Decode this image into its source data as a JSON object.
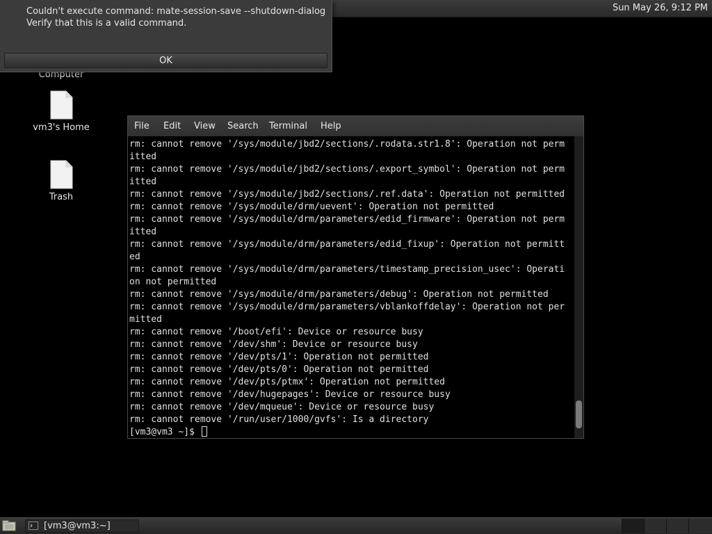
{
  "top_panel": {
    "clock": "Sun May 26,  9:12 PM"
  },
  "error_dialog": {
    "line1": "Couldn't execute command: mate-session-save --shutdown-dialog",
    "line2": "Verify that this is a valid command.",
    "ok_label": "OK"
  },
  "desktop_icons": {
    "computer": "Computer",
    "home": "vm3's Home",
    "trash": "Trash"
  },
  "terminal": {
    "menu": [
      "File",
      "Edit",
      "View",
      "Search",
      "Terminal",
      "Help"
    ],
    "lines": [
      "rm: cannot remove '/sys/module/jbd2/sections/.rodata.str1.8': Operation not perm",
      "itted",
      "rm: cannot remove '/sys/module/jbd2/sections/.export_symbol': Operation not perm",
      "itted",
      "rm: cannot remove '/sys/module/jbd2/sections/.ref.data': Operation not permitted",
      "rm: cannot remove '/sys/module/drm/uevent': Operation not permitted",
      "rm: cannot remove '/sys/module/drm/parameters/edid_firmware': Operation not perm",
      "itted",
      "rm: cannot remove '/sys/module/drm/parameters/edid_fixup': Operation not permitt",
      "ed",
      "rm: cannot remove '/sys/module/drm/parameters/timestamp_precision_usec': Operati",
      "on not permitted",
      "rm: cannot remove '/sys/module/drm/parameters/debug': Operation not permitted",
      "rm: cannot remove '/sys/module/drm/parameters/vblankoffdelay': Operation not per",
      "mitted",
      "rm: cannot remove '/boot/efi': Device or resource busy",
      "rm: cannot remove '/dev/shm': Device or resource busy",
      "rm: cannot remove '/dev/pts/1': Operation not permitted",
      "rm: cannot remove '/dev/pts/0': Operation not permitted",
      "rm: cannot remove '/dev/pts/ptmx': Operation not permitted",
      "rm: cannot remove '/dev/hugepages': Device or resource busy",
      "rm: cannot remove '/dev/mqueue': Device or resource busy",
      "rm: cannot remove '/run/user/1000/gvfs': Is a directory"
    ],
    "prompt": "[vm3@vm3 ~]$ "
  },
  "taskbar": {
    "window_label": "[vm3@vm3:~]"
  },
  "icons": {
    "show_desktop": "show-desktop-icon",
    "terminal": "terminal-icon",
    "file": "document-icon"
  }
}
